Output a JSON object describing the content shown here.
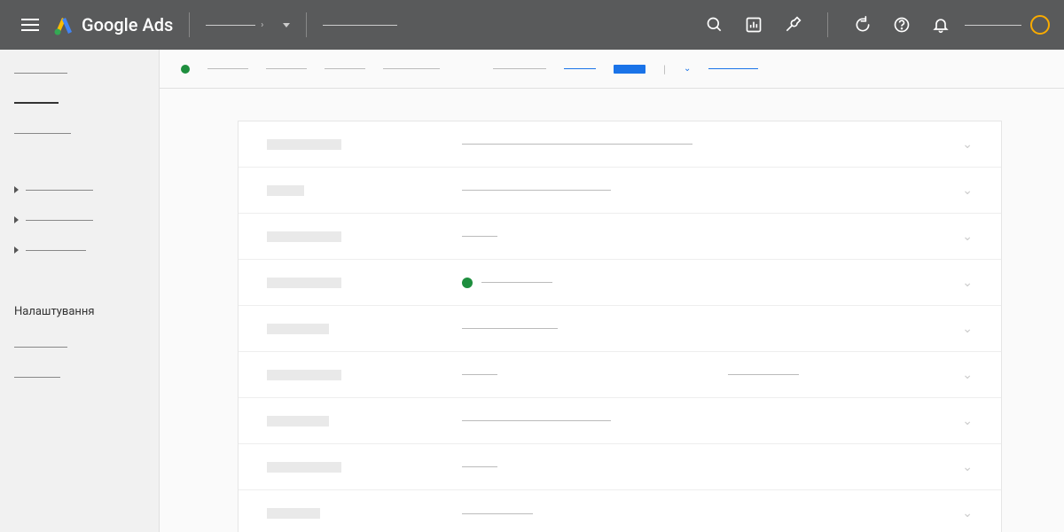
{
  "header": {
    "brand": "Google Ads"
  },
  "sidebar": {
    "settings_label": "Налаштування"
  },
  "rows_count": 9,
  "row_label_widths": [
    84,
    42,
    84,
    84,
    70,
    84,
    70,
    84,
    60
  ],
  "row_val1_widths": [
    260,
    168,
    40,
    80,
    108,
    40,
    168,
    40,
    80
  ],
  "row_val2_widths": [
    0,
    0,
    0,
    0,
    0,
    80,
    0,
    0,
    0
  ],
  "row_has_dot": [
    false,
    false,
    false,
    true,
    false,
    false,
    false,
    false,
    false
  ]
}
